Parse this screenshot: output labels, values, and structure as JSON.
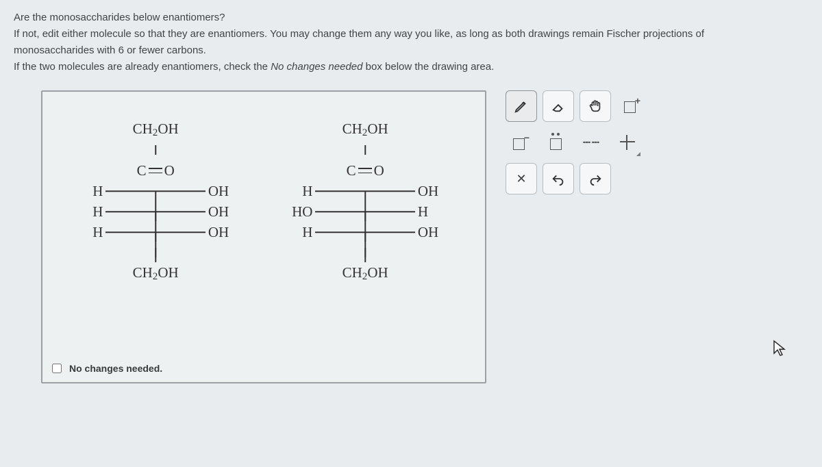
{
  "question": {
    "line1": "Are the monosaccharides below enantiomers?",
    "line2a": "If not, edit either molecule so that they are enantiomers. You may change them any way you like, as long as both drawings remain Fischer projections of",
    "line2b": "monosaccharides with 6 or fewer carbons.",
    "line3a": "If the two molecules are already enantiomers, check the ",
    "line3_ital": "No changes needed",
    "line3b": " box below the drawing area."
  },
  "molecules": {
    "left": {
      "top": "CH₂OH",
      "c_dbl_o_left": "C",
      "c_dbl_o_right": "O",
      "stereo": [
        {
          "l": "H",
          "r": "OH"
        },
        {
          "l": "H",
          "r": "OH"
        },
        {
          "l": "H",
          "r": "OH"
        }
      ],
      "bottom": "CH₂OH"
    },
    "right": {
      "top": "CH₂OH",
      "c_dbl_o_left": "C",
      "c_dbl_o_right": "O",
      "stereo": [
        {
          "l": "H",
          "r": "OH"
        },
        {
          "l": "HO",
          "r": "H"
        },
        {
          "l": "H",
          "r": "OH"
        }
      ],
      "bottom": "CH₂OH"
    }
  },
  "no_changes_label": "No changes needed.",
  "tools": {
    "pencil": "pencil",
    "eraser": "eraser",
    "hand": "hand",
    "new": "new-molecule",
    "neg": "□⁻",
    "lone": "lone-pair",
    "bond": "bond-tool",
    "stereo": "stereo-center",
    "delete": "✕",
    "undo": "↶",
    "redo": "↻"
  }
}
